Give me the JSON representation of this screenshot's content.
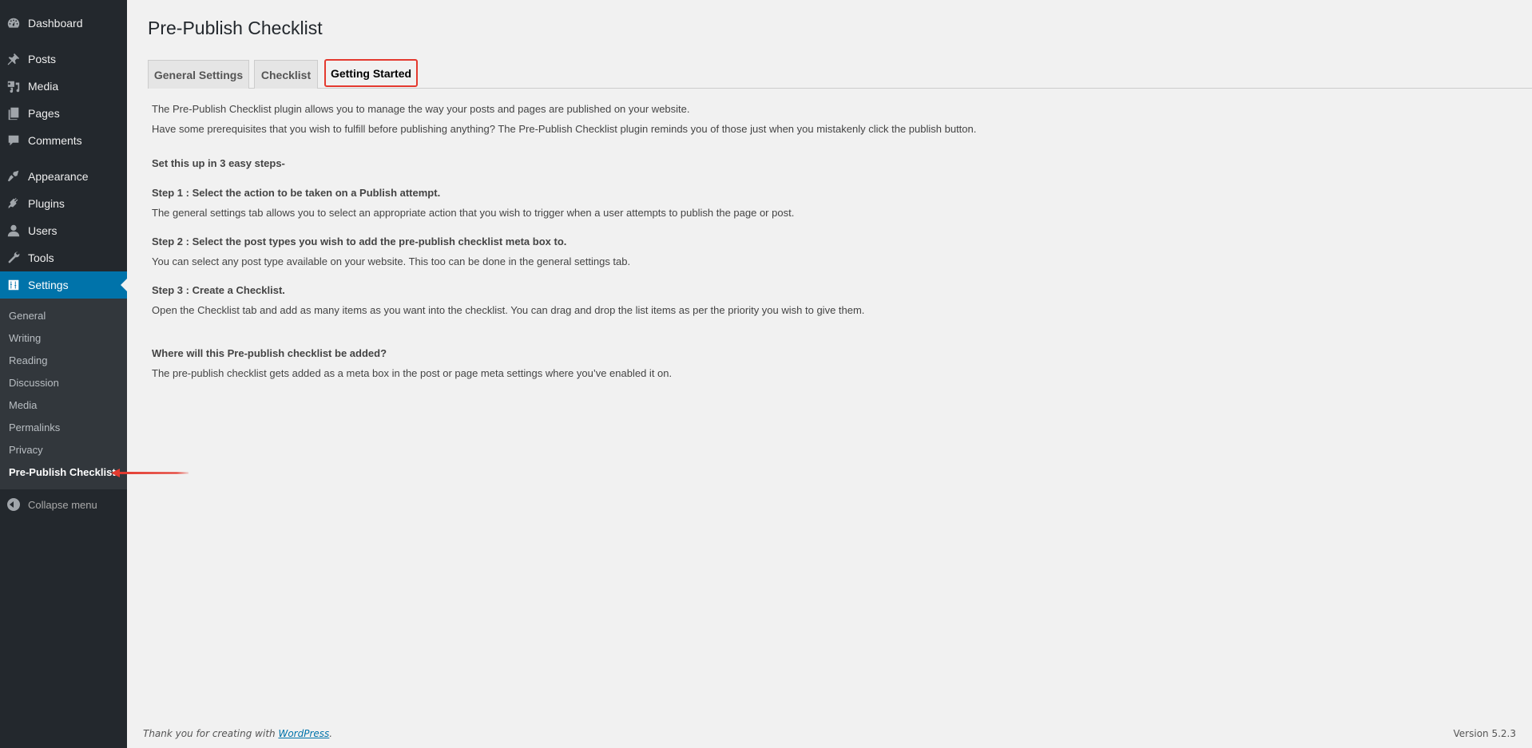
{
  "sidebar": {
    "items": [
      {
        "label": "Dashboard",
        "icon": "dashboard-icon"
      },
      {
        "label": "Posts",
        "icon": "pin-icon"
      },
      {
        "label": "Media",
        "icon": "media-icon"
      },
      {
        "label": "Pages",
        "icon": "pages-icon"
      },
      {
        "label": "Comments",
        "icon": "comment-icon"
      },
      {
        "label": "Appearance",
        "icon": "paintbrush-icon"
      },
      {
        "label": "Plugins",
        "icon": "plugin-icon"
      },
      {
        "label": "Users",
        "icon": "user-icon"
      },
      {
        "label": "Tools",
        "icon": "wrench-icon"
      },
      {
        "label": "Settings",
        "icon": "settings-icon"
      }
    ],
    "submenu": [
      {
        "label": "General"
      },
      {
        "label": "Writing"
      },
      {
        "label": "Reading"
      },
      {
        "label": "Discussion"
      },
      {
        "label": "Media"
      },
      {
        "label": "Permalinks"
      },
      {
        "label": "Privacy"
      },
      {
        "label": "Pre-Publish Checklist"
      }
    ],
    "collapse_label": "Collapse menu"
  },
  "page": {
    "title": "Pre-Publish Checklist",
    "tabs": [
      {
        "label": "General Settings"
      },
      {
        "label": "Checklist"
      },
      {
        "label": "Getting Started"
      }
    ],
    "active_tab": "Getting Started",
    "content": {
      "intro1": "The Pre-Publish Checklist plugin allows you to manage the way your posts and pages are published on your website.",
      "intro2": "Have some prerequisites that you wish to fulfill before publishing anything? The Pre-Publish Checklist plugin reminds you of those just when you mistakenly click the publish button.",
      "steps_heading": "Set this up in 3 easy steps-",
      "step1_title": "Step 1 : Select the action to be taken on a Publish attempt.",
      "step1_text": "The general settings tab allows you to select an appropriate action that you wish to trigger when a user attempts to publish the page or post.",
      "step2_title": "Step 2 : Select the post types you wish to add the pre-publish checklist meta box to.",
      "step2_text": "You can select any post type available on your website. This too can be done in the general settings tab.",
      "step3_title": "Step 3 : Create a Checklist.",
      "step3_text": "Open the Checklist tab and add as many items as you want into the checklist. You can drag and drop the list items as per the priority you wish to give them.",
      "where_title": "Where will this Pre-publish checklist be added?",
      "where_text": "The pre-publish checklist gets added as a meta box in the post or page meta settings where you’ve enabled it on."
    }
  },
  "footer": {
    "thanks_prefix": "Thank you for creating with ",
    "link_label": "WordPress",
    "thanks_suffix": ".",
    "version": "Version 5.2.3"
  },
  "colors": {
    "sidebar_bg": "#23282d",
    "submenu_bg": "#32373c",
    "accent": "#0073aa",
    "annotation": "#e43a2f"
  }
}
